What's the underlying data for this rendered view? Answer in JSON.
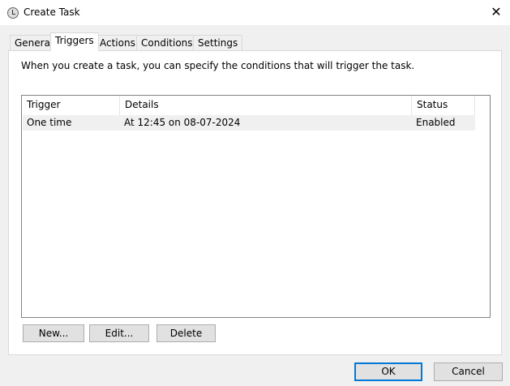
{
  "window": {
    "title": "Create Task",
    "close": "✕"
  },
  "tabs": [
    "General",
    "Triggers",
    "Actions",
    "Conditions",
    "Settings"
  ],
  "description": "When you create a task, you can specify the conditions that will trigger the task.",
  "table": {
    "columns": [
      "Trigger",
      "Details",
      "Status"
    ],
    "rows": [
      [
        "One time",
        "At 12:45 on 08-07-2024",
        "Enabled"
      ]
    ]
  },
  "buttons": {
    "new": "New...",
    "edit": "Edit...",
    "delete": "Delete",
    "ok": "OK",
    "cancel": "Cancel"
  }
}
